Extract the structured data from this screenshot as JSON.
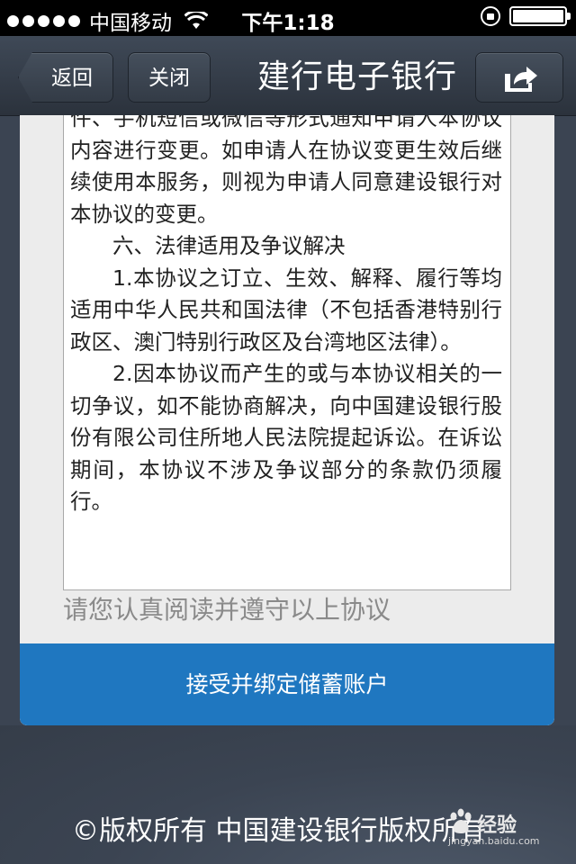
{
  "status_bar": {
    "carrier": "中国移动",
    "time": "下午1:18"
  },
  "nav": {
    "back_label": "返回",
    "close_label": "关闭",
    "title": "建行电子银行",
    "share_icon": "share-icon"
  },
  "agreement": {
    "paragraphs": [
      "件、手机短信或微信等形式通知申请人本协议内容进行变更。如申请人在协议变更生效后继续使用本服务，则视为申请人同意建设银行对本协议的变更。",
      "六、法律适用及争议解决",
      "1.本协议之订立、生效、解释、履行等均适用中华人民共和国法律（不包括香港特别行政区、澳门特别行政区及台湾地区法律）。",
      "2.因本协议而产生的或与本协议相关的一切争议，如不能协商解决，向中国建设银行股份有限公司住所地人民法院提起诉讼。在诉讼期间，本协议不涉及争议部分的条款仍须履行。"
    ]
  },
  "notice": "请您认真阅读并遵守以上协议",
  "accept_button": "接受并绑定储蓄账户",
  "footer": {
    "copyright": "©版权所有 中国建设银行版权所有"
  },
  "watermark": {
    "title": "经验",
    "url": "jingyan.baidu.com"
  },
  "colors": {
    "accent_button": "#1f77c0",
    "nav_background": "#3b4452"
  }
}
